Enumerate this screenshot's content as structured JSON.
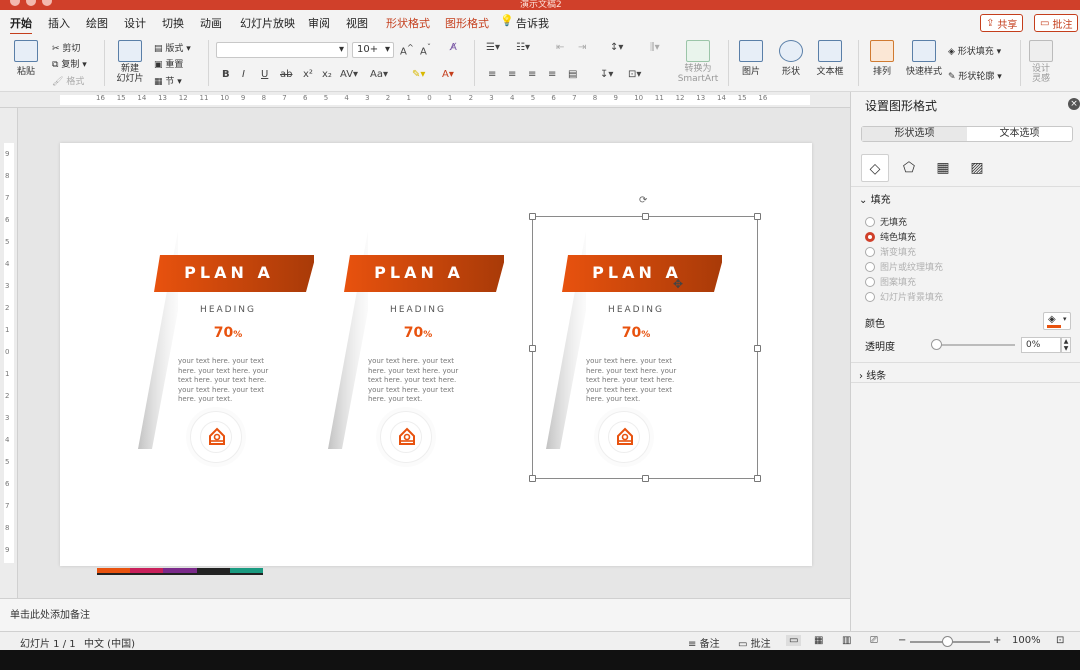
{
  "window": {
    "title": "演示文稿2"
  },
  "tabs": [
    {
      "label": "开始",
      "active": true
    },
    {
      "label": "插入"
    },
    {
      "label": "绘图"
    },
    {
      "label": "设计"
    },
    {
      "label": "切换"
    },
    {
      "label": "动画"
    },
    {
      "label": "幻灯片放映"
    },
    {
      "label": "审阅"
    },
    {
      "label": "视图"
    },
    {
      "label": "形状格式",
      "contextual": true
    },
    {
      "label": "图形格式",
      "contextual": true
    },
    {
      "label": "告诉我"
    }
  ],
  "header_actions": {
    "share": "共享",
    "comment": "批注"
  },
  "ribbon": {
    "paste": "粘贴",
    "cut": "剪切",
    "copy": "复制",
    "format": "格式",
    "new_slide": "新建\n幻灯片",
    "layout": "版式",
    "reset": "重置",
    "section": "节",
    "font_name": "",
    "font_size": "10+",
    "convert_smartart": "转换为\nSmartArt",
    "picture": "图片",
    "shape": "形状",
    "textbox": "文本框",
    "arrange": "排列",
    "quick_styles": "快速样式",
    "shape_fill": "形状填充",
    "shape_outline": "形状轮廓",
    "design_ideas": "设计\n灵感"
  },
  "slide": {
    "cards": [
      {
        "title": "PLAN A",
        "heading": "HEADING",
        "percent": "70",
        "percent_unit": "%",
        "body": "your text here. your text here. your text here. your text here. your text here. your text here. your text here. your text."
      },
      {
        "title": "PLAN A",
        "heading": "HEADING",
        "percent": "70",
        "percent_unit": "%",
        "body": "your text here. your text here. your text here. your text here. your text here. your text here. your text here. your text."
      },
      {
        "title": "PLAN A",
        "heading": "HEADING",
        "percent": "70",
        "percent_unit": "%",
        "body": "your text here. your text here. your text here. your text here. your text here. your text here. your text here. your text."
      }
    ],
    "accent_color": "#e8520e",
    "accent_dark": "#a83a08",
    "colorbar": [
      "#e8520e",
      "#c8205a",
      "#7a2a8a",
      "#222222",
      "#1a9a80"
    ]
  },
  "notes_placeholder": "单击此处添加备注",
  "format_panel": {
    "title": "设置图形格式",
    "tabs": [
      "形状选项",
      "文本选项"
    ],
    "fill_section": "填充",
    "fill_options": [
      {
        "label": "无填充",
        "state": "normal"
      },
      {
        "label": "纯色填充",
        "state": "selected"
      },
      {
        "label": "渐变填充",
        "state": "disabled"
      },
      {
        "label": "图片或纹理填充",
        "state": "disabled"
      },
      {
        "label": "图案填充",
        "state": "disabled"
      },
      {
        "label": "幻灯片背景填充",
        "state": "disabled"
      }
    ],
    "color_label": "颜色",
    "transparency_label": "透明度",
    "transparency_value": "0%",
    "line_section": "线条"
  },
  "status": {
    "slide_info": "幻灯片 1 / 1",
    "language": "中文 (中国)",
    "notes": "备注",
    "comments": "批注",
    "zoom": "100%"
  },
  "ruler_numbers_h": [
    "16",
    "15",
    "14",
    "13",
    "12",
    "11",
    "10",
    "9",
    "8",
    "7",
    "6",
    "5",
    "4",
    "3",
    "2",
    "1",
    "0",
    "1",
    "2",
    "3",
    "4",
    "5",
    "6",
    "7",
    "8",
    "9",
    "10",
    "11",
    "12",
    "13",
    "14",
    "15",
    "16"
  ],
  "ruler_numbers_v": [
    "9",
    "8",
    "7",
    "6",
    "5",
    "4",
    "3",
    "2",
    "1",
    "0",
    "1",
    "2",
    "3",
    "4",
    "5",
    "6",
    "7",
    "8",
    "9"
  ]
}
